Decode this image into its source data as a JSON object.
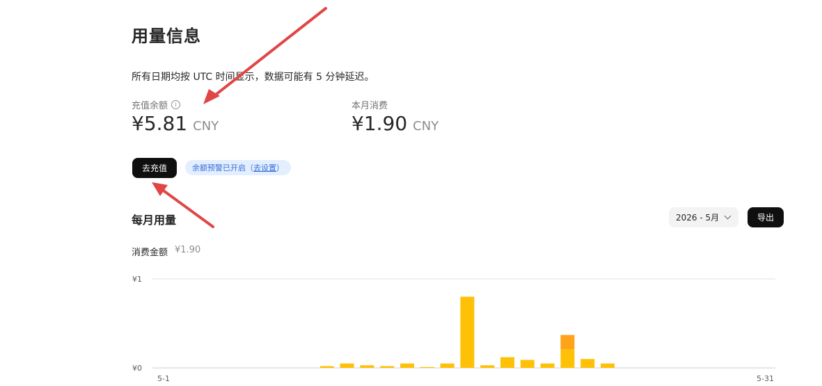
{
  "page": {
    "title": "用量信息",
    "notice": "所有日期均按 UTC 时间显示，数据可能有 5 分钟延迟。"
  },
  "balance": {
    "label": "充值余额",
    "info_icon": "info-icon",
    "amount": "¥5.81",
    "unit": "CNY"
  },
  "month_spend": {
    "label": "本月消费",
    "amount": "¥1.90",
    "unit": "CNY"
  },
  "actions": {
    "recharge_label": "去充值",
    "alert_text": "余额预警已开启（",
    "alert_link": "去设置",
    "alert_close": "）"
  },
  "monthly": {
    "title": "每月用量",
    "month_value": "2026 - 5月",
    "export_label": "导出",
    "total_label": "消费金额",
    "total_value": "¥1.90"
  },
  "colors": {
    "primary_bar": "#FFC107",
    "secondary_bar": "#FFA31A",
    "arrow": "#E04646"
  },
  "chart_data": {
    "type": "bar",
    "stacked": true,
    "x_tick_labels": [
      "5-1",
      "5-31"
    ],
    "y_tick_labels": [
      "¥1",
      "¥0"
    ],
    "ylim": [
      0,
      1
    ],
    "grid": true,
    "days": [
      1,
      2,
      3,
      4,
      5,
      6,
      7,
      8,
      9,
      10,
      11,
      12,
      13,
      14,
      15,
      16,
      17,
      18,
      19,
      20,
      21,
      22,
      23,
      24,
      25,
      26,
      27,
      28,
      29,
      30,
      31
    ],
    "series": [
      {
        "color": "#FFC107",
        "values": [
          0,
          0,
          0,
          0,
          0,
          0,
          0,
          0,
          0.02,
          0.05,
          0.03,
          0.02,
          0.05,
          0.01,
          0.05,
          0.8,
          0.03,
          0.12,
          0.09,
          0.05,
          0.21,
          0.1,
          0.05,
          0,
          0,
          0,
          0,
          0,
          0,
          0,
          0
        ]
      },
      {
        "color": "#FFA31A",
        "values": [
          0,
          0,
          0,
          0,
          0,
          0,
          0,
          0,
          0,
          0,
          0,
          0,
          0,
          0,
          0,
          0,
          0,
          0,
          0,
          0,
          0.16,
          0,
          0,
          0,
          0,
          0,
          0,
          0,
          0,
          0,
          0
        ]
      }
    ]
  }
}
